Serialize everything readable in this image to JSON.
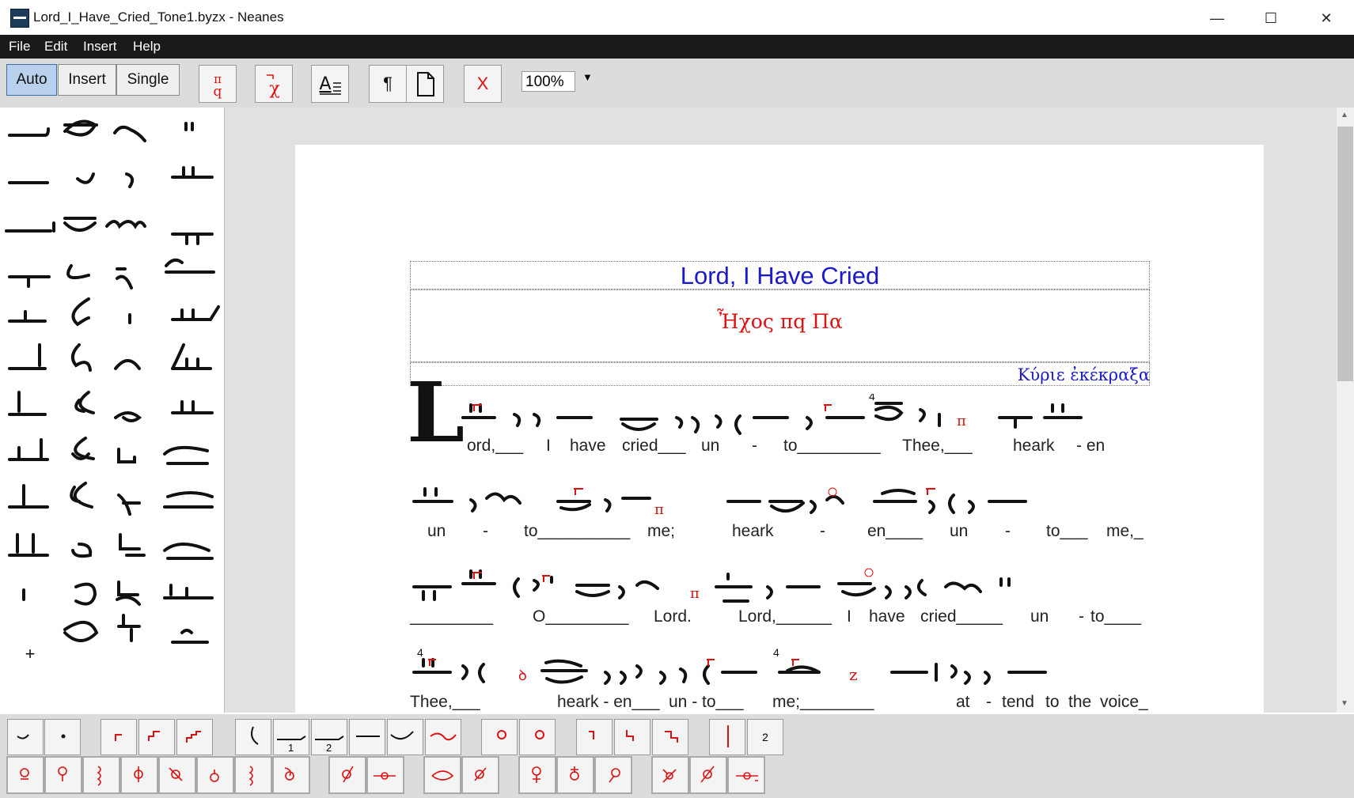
{
  "window": {
    "title": "Lord_I_Have_Cried_Tone1.byzx - Neanes",
    "minimize": "—",
    "maximize": "☐",
    "close": "✕"
  },
  "menu": [
    "File",
    "Edit",
    "Insert",
    "Help"
  ],
  "toolbar": {
    "modes": [
      "Auto",
      "Insert",
      "Single"
    ],
    "selected_mode": "Auto",
    "mode_key_glyph": "π\nq",
    "martyria_glyph": "χ",
    "text_box_glyph": "A",
    "paragraph_glyph": "¶",
    "page_glyph": "🗋",
    "delete_glyph": "X",
    "zoom_value": "100%",
    "zoom_arrow": "▼"
  },
  "score": {
    "title": "Lord, I Have Cried",
    "mode_line": "Ἦχος  πq  Πα",
    "ison_label": "Κύριε ἐκέκραξα",
    "drop_cap": "L",
    "lyric_lines": [
      [
        "ord,___",
        "I",
        "have",
        "cried___",
        "un",
        "-",
        "to_________",
        "Thee,___",
        "heark",
        "- en"
      ],
      [
        "un",
        "-",
        "to__________",
        "me;",
        "heark",
        "-",
        "en____",
        "un",
        "-",
        "to___",
        "me,_"
      ],
      [
        "_________",
        "O_________",
        "Lord.",
        "Lord,______",
        "I",
        "have",
        "cried_____",
        "un",
        "-",
        "to____"
      ],
      [
        "Thee,___",
        "heark - en___",
        "un - to___",
        "me;________",
        "at",
        "-",
        "tend",
        "to",
        "the",
        "voice_"
      ]
    ],
    "accent_numbers": [
      "4",
      "4",
      "4"
    ]
  },
  "bottom_palette": {
    "row1_labels": [
      "1",
      "2",
      "2"
    ]
  },
  "colors": {
    "accent_red": "#d11111",
    "title_blue": "#1a1acc",
    "menu_bg": "#1a1a1a"
  }
}
